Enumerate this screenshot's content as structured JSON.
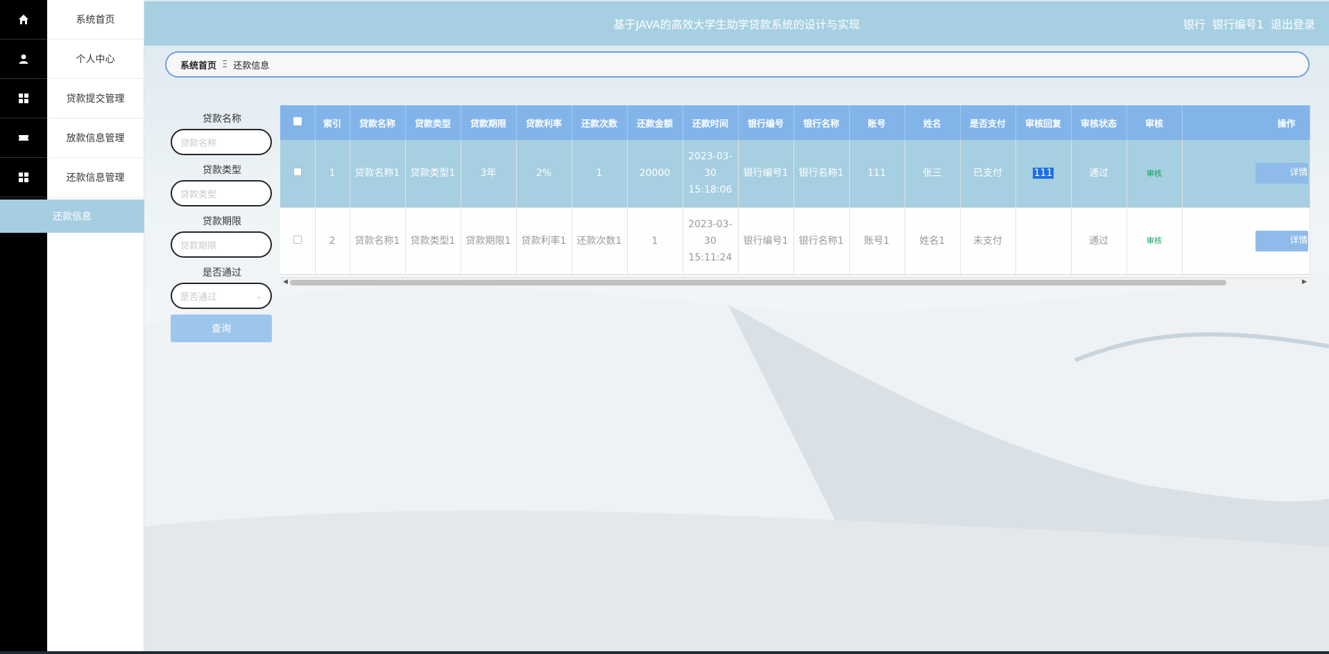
{
  "app": {
    "title": "基于JAVA的高效大学生助学贷款系统的设计与实现",
    "user_role": "银行",
    "user_name": "银行编号1",
    "logout": "退出登录"
  },
  "sidebar": {
    "items": [
      {
        "label": "系统首页",
        "icon": "home-icon"
      },
      {
        "label": "个人中心",
        "icon": "user-icon"
      },
      {
        "label": "贷款提交管理",
        "icon": "grid-icon"
      },
      {
        "label": "放款信息管理",
        "icon": "ticket-icon"
      },
      {
        "label": "还款信息管理",
        "icon": "grid-icon"
      }
    ],
    "submenu_active": "还款信息"
  },
  "breadcrumb": {
    "home": "系统首页",
    "separator": "Ξ",
    "current": "还款信息"
  },
  "search": {
    "fields": [
      {
        "label": "贷款名称",
        "placeholder": "贷款名称"
      },
      {
        "label": "贷款类型",
        "placeholder": "贷款类型"
      },
      {
        "label": "贷款期限",
        "placeholder": "贷款期限"
      }
    ],
    "select": {
      "label": "是否通过",
      "placeholder": "是否通过"
    },
    "button": "查询"
  },
  "table": {
    "headers": [
      "索引",
      "贷款名称",
      "贷款类型",
      "贷款期限",
      "贷款利率",
      "还款次数",
      "还款金额",
      "还款时间",
      "银行编号",
      "银行名称",
      "账号",
      "姓名",
      "是否支付",
      "审核回复",
      "审核状态",
      "审核",
      "操作"
    ],
    "rows": [
      {
        "index": "1",
        "loan_name": "贷款名称1",
        "loan_type": "贷款类型1",
        "loan_term": "3年",
        "interest_rate": "2%",
        "repay_count": "1",
        "repay_amount": "20000",
        "repay_time": "2023-03-30 15:18:06",
        "bank_no": "银行编号1",
        "bank_name": "银行名称1",
        "account": "111",
        "name": "张三",
        "paid": "已支付",
        "audit_reply": "111",
        "audit_status": "通过",
        "audit_action": "审核",
        "detail": "详情"
      },
      {
        "index": "2",
        "loan_name": "贷款名称1",
        "loan_type": "贷款类型1",
        "loan_term": "贷款期限1",
        "interest_rate": "贷款利率1",
        "repay_count": "还款次数1",
        "repay_amount": "1",
        "repay_time": "2023-03-30 15:11:24",
        "bank_no": "银行编号1",
        "bank_name": "银行名称1",
        "account": "账号1",
        "name": "姓名1",
        "paid": "未支付",
        "audit_reply": "",
        "audit_status": "通过",
        "audit_action": "审核",
        "detail": "详情"
      }
    ]
  },
  "colors": {
    "header_bg": "#a6d0e2",
    "table_header_bg": "#82b4ea",
    "selected_row_bg": "#a6cfe1",
    "audit_link": "#16a05a"
  }
}
